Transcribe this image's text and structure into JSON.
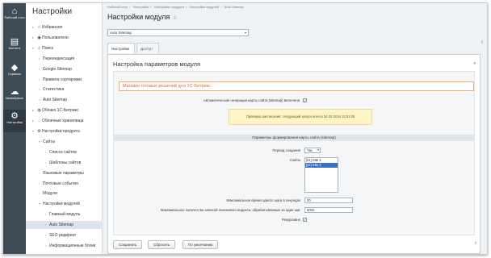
{
  "iconbar": [
    {
      "icon": "home-icon",
      "glyph": "⌂",
      "label": "Рабочий стол",
      "label2": "стол"
    },
    {
      "icon": "document-icon",
      "glyph": "▤",
      "label": "Контент"
    },
    {
      "icon": "layers-icon",
      "glyph": "◆",
      "label": "Сервисы"
    },
    {
      "icon": "cloud-icon",
      "glyph": "☁",
      "label": "Marketplace"
    },
    {
      "icon": "gear-icon",
      "glyph": "⚙",
      "label": "Настройки"
    }
  ],
  "menu": {
    "title": "Настройки",
    "items": [
      {
        "label": "Избранное",
        "level": 0,
        "arrow": "▸",
        "icon": "☆"
      },
      {
        "label": "Пользователи",
        "level": 0,
        "arrow": "▸",
        "icon": "◉"
      },
      {
        "label": "Поиск",
        "level": 0,
        "arrow": "▾",
        "icon": "⌕"
      },
      {
        "label": "Переиндексация",
        "level": 1
      },
      {
        "label": "Google Sitemap",
        "level": 1
      },
      {
        "label": "Правила сортировки",
        "level": 1
      },
      {
        "label": "Статистика",
        "level": 1
      },
      {
        "label": "Auto Sitemap",
        "level": 1
      },
      {
        "label": "Облако 1С-Битрикс",
        "level": 0,
        "arrow": "▸",
        "icon": "◍"
      },
      {
        "label": "Облачные хранилища",
        "level": 0,
        "arrow": "▸",
        "icon": "◌"
      },
      {
        "label": "Настройки продукта",
        "level": 0,
        "arrow": "▾",
        "icon": "⚙"
      },
      {
        "label": "Сайты",
        "level": 1,
        "arrow": "▾"
      },
      {
        "label": "Список сайтов",
        "level": 2
      },
      {
        "label": "Шаблоны сайтов",
        "level": 2
      },
      {
        "label": "Языковые параметры",
        "level": 1
      },
      {
        "label": "Почтовые события",
        "level": 1
      },
      {
        "label": "Модули",
        "level": 1
      },
      {
        "label": "Настройки модулей",
        "level": 1,
        "arrow": "▾"
      },
      {
        "label": "Главный модуль",
        "level": 2
      },
      {
        "label": "Auto Sitemap",
        "level": 2,
        "selected": true
      },
      {
        "label": "SEO редирект",
        "level": 2
      },
      {
        "label": "Информационные блоки",
        "level": 2
      }
    ]
  },
  "breadcrumbs": [
    "Рабочий стол",
    "Настройки",
    "Настройки продукта",
    "Настройки модулей",
    "Auto Sitemap"
  ],
  "page_title": "Настройки модуля",
  "module_select": "Auto Sitemap",
  "tabs": [
    "Настройки",
    "Доступ"
  ],
  "panel": {
    "heading": "Настройка параметров модуля",
    "shop_link": "Магазин готовых решений для 1С-Битрикс",
    "auto_gen_label": "Автоматическая генерация карты сайта (sitemap) включена",
    "auto_gen_checked": "✓",
    "notice_prefix": "Проверка расписания:",
    "notice_main": "следующий запуск агента 24.02.2016 12:51:06",
    "section_head": "Параметры формирования карты сайта (sitemap)",
    "period_label": "Период создания",
    "period_value": "Час",
    "sites_label": "Сайты",
    "sites": [
      {
        "label": "[s1] Site 1",
        "selected": false
      },
      {
        "label": "[s2] Site 2",
        "selected": true
      }
    ],
    "max_time_label": "Максимальное время одного шага в секундах",
    "max_time_value": "30",
    "max_records_label": "Максимальное количество записей поискового индекса, обрабатываемых за один шаг",
    "max_records_value": "5000",
    "recursive_label": "Рекурсивно",
    "recursive_checked": "✓"
  },
  "buttons": {
    "save": "Сохранить",
    "reset": "Сбросить",
    "defaults": "По умолчанию"
  },
  "colors": {
    "accent_orange": "#e36a2b",
    "sidebar_dark": "#3f4b55",
    "selected_option": "#3b6fc6"
  }
}
